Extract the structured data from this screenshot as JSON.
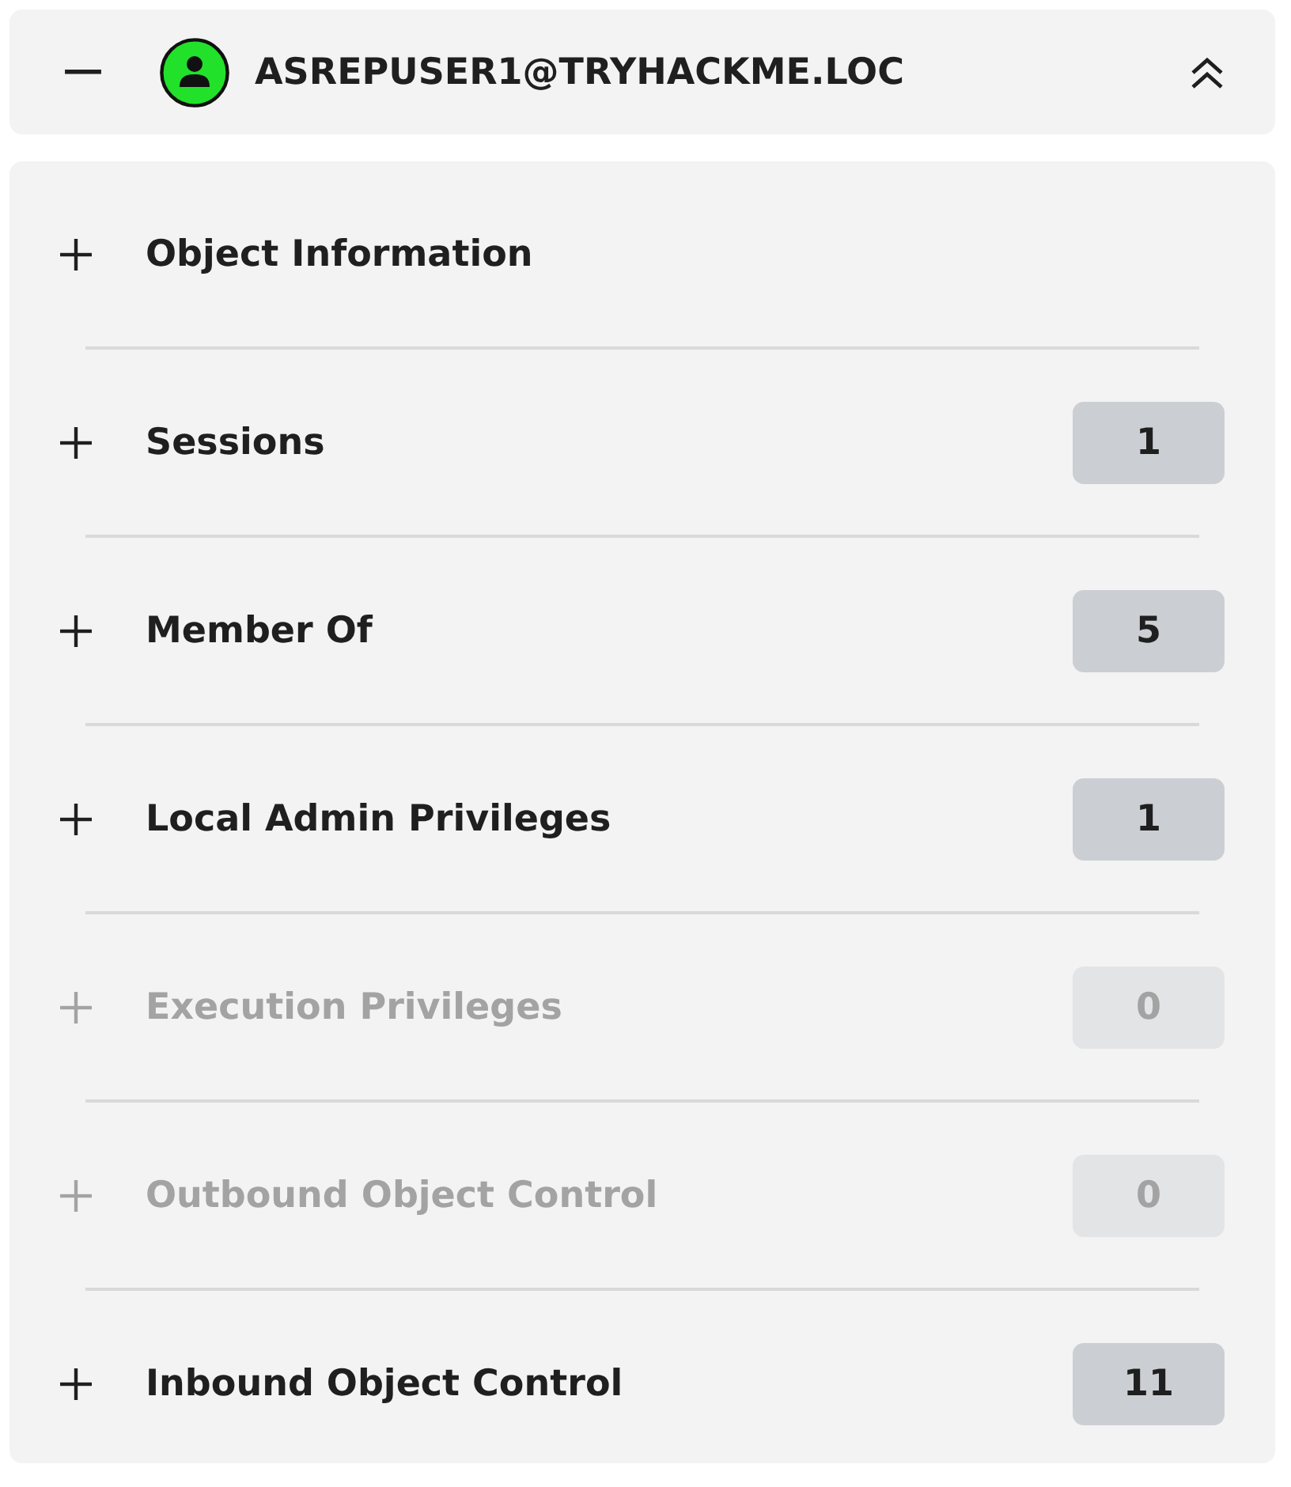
{
  "header": {
    "title": "ASREPUSER1@TRYHACKME.LOC",
    "expanded": true
  },
  "sections": [
    {
      "label": "Object Information",
      "expanded": false,
      "disabled": false
    },
    {
      "label": "Sessions",
      "count": "1",
      "expanded": false,
      "disabled": false
    },
    {
      "label": "Member Of",
      "count": "5",
      "expanded": false,
      "disabled": false
    },
    {
      "label": "Local Admin Privileges",
      "count": "1",
      "expanded": false,
      "disabled": false
    },
    {
      "label": "Execution Privileges",
      "count": "0",
      "expanded": false,
      "disabled": true
    },
    {
      "label": "Outbound Object Control",
      "count": "0",
      "expanded": false,
      "disabled": true
    },
    {
      "label": "Inbound Object Control",
      "count": "11",
      "expanded": false,
      "disabled": false
    }
  ]
}
